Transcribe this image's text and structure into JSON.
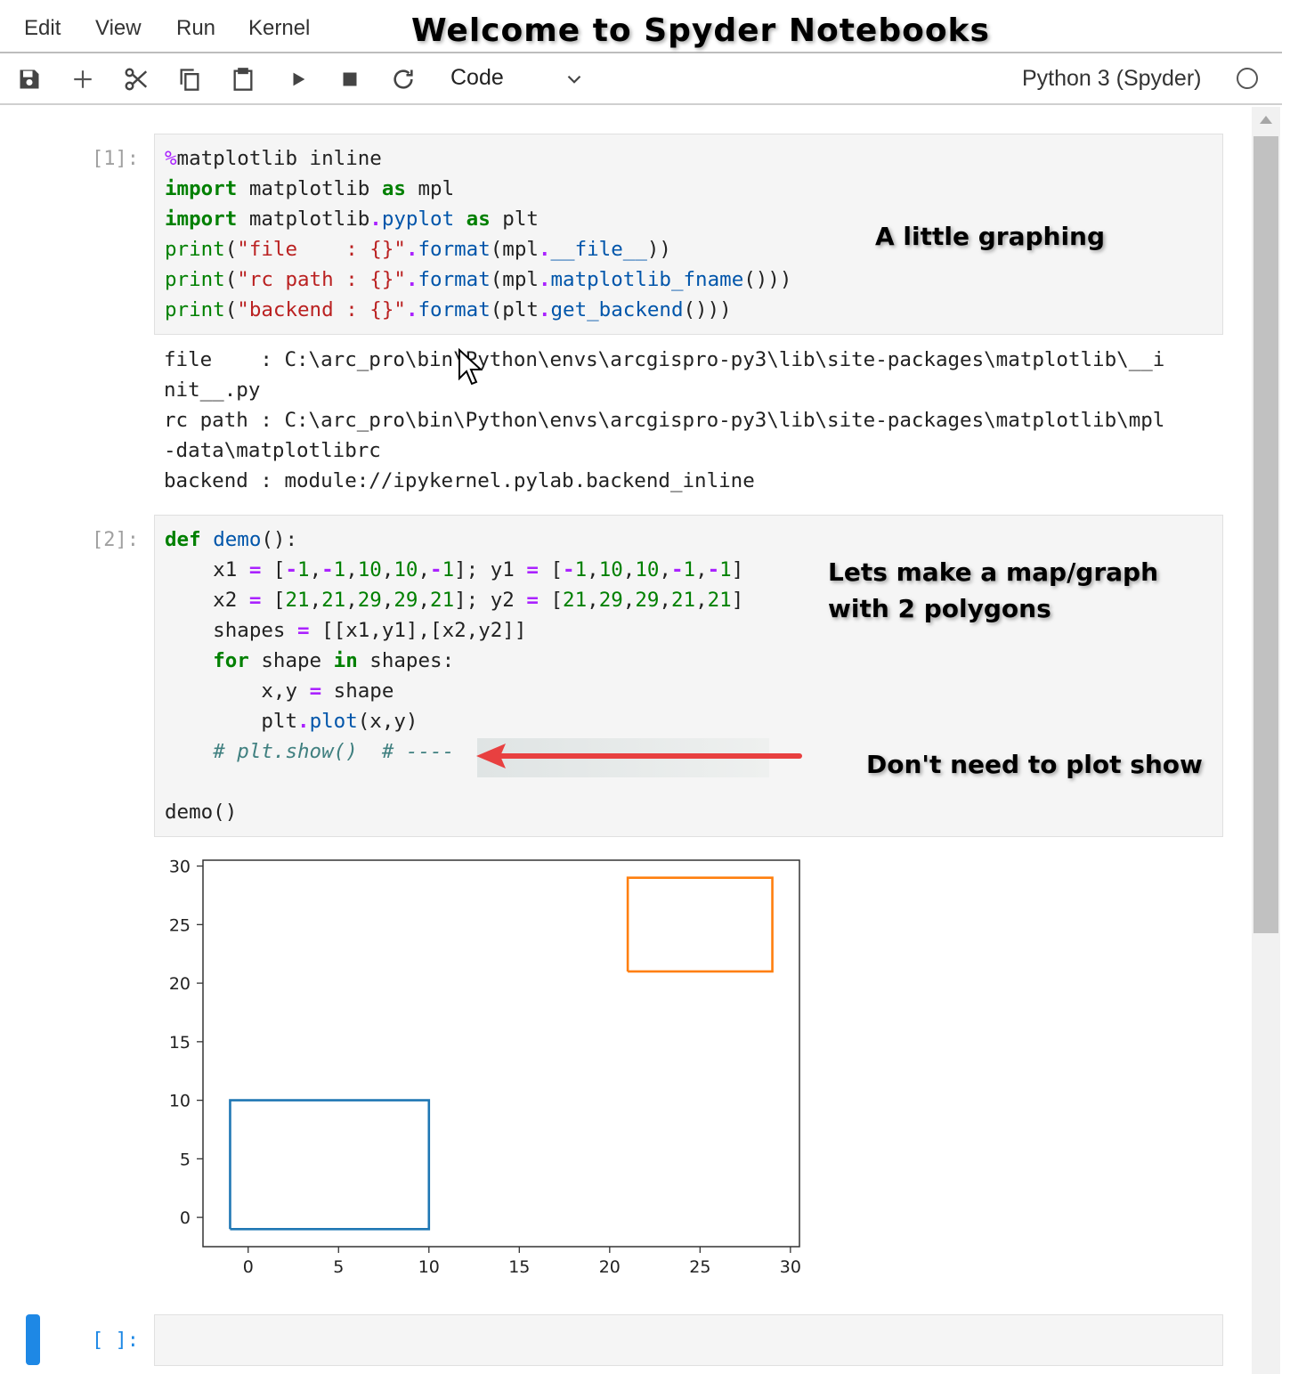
{
  "menu": {
    "edit": "Edit",
    "view": "View",
    "run": "Run",
    "kernel": "Kernel"
  },
  "title": "Welcome to Spyder Notebooks",
  "toolbar": {
    "icons": [
      "save-icon",
      "add-cell-icon",
      "cut-icon",
      "copy-icon",
      "paste-icon",
      "run-icon",
      "stop-icon",
      "restart-icon"
    ],
    "cell_type": "Code",
    "kernel_name": "Python 3 (Spyder)"
  },
  "cells": [
    {
      "prompt": "[1]:",
      "annotation": "A little graphing",
      "output": [
        "file    : C:\\arc_pro\\bin\\Python\\envs\\arcgispro-py3\\lib\\site-packages\\matplotlib\\__i",
        "nit__.py",
        "rc path : C:\\arc_pro\\bin\\Python\\envs\\arcgispro-py3\\lib\\site-packages\\matplotlib\\mpl",
        "-data\\matplotlibrc",
        "backend : module://ipykernel.pylab.backend_inline"
      ]
    },
    {
      "prompt": "[2]:",
      "annotation_lines": [
        "Lets make a map/graph",
        "with 2 polygons"
      ],
      "annotation_2": "Don't need to plot show"
    },
    {
      "prompt": "[ ]:"
    }
  ],
  "colors": {
    "accent": "#1e88e5",
    "series1": "#1f77b4",
    "series2": "#ff7f0e",
    "arrow": "#e84040"
  },
  "chart_data": {
    "type": "line",
    "xlim": [
      -2.5,
      30.5
    ],
    "ylim": [
      -2.5,
      30.5
    ],
    "xticks": [
      0,
      5,
      10,
      15,
      20,
      25,
      30
    ],
    "yticks": [
      0,
      5,
      10,
      15,
      20,
      25,
      30
    ],
    "grid": false,
    "series": [
      {
        "x": [
          -1,
          -1,
          10,
          10,
          -1
        ],
        "y": [
          -1,
          10,
          10,
          -1,
          -1
        ],
        "color": "#1f77b4"
      },
      {
        "x": [
          21,
          21,
          29,
          29,
          21
        ],
        "y": [
          21,
          29,
          29,
          21,
          21
        ],
        "color": "#ff7f0e"
      }
    ]
  }
}
